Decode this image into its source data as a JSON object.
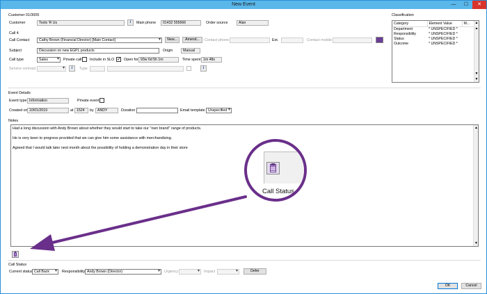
{
  "window": {
    "title": "New Event",
    "minimize": "—",
    "maximize": "☐",
    "close": "✕"
  },
  "header": {
    "customer_ref": "Customer 01/3005"
  },
  "customer": {
    "customer_label": "Customer",
    "customer_value": "Tools 'R Us",
    "main_phone_label": "Main phone",
    "main_phone_value": "01432 555666",
    "order_source_label": "Order source",
    "order_source_value": "Alan"
  },
  "call": {
    "section": "Call 4",
    "contact_label": "Call Contact",
    "contact_value": "Cathy Brown (Financial Director) [Main Contact]",
    "new_button": "New...",
    "amend_button": "Amend...",
    "contact_phone_label": "Contact phone",
    "ext_label": "Ext.",
    "contact_mobile_label": "Contact mobile",
    "subject_label": "Subject",
    "subject_value": "Discussion on new EGPL products",
    "origin_label": "Origin",
    "origin_value": "Manual",
    "call_type_label": "Call type",
    "call_type_value": "Sales",
    "private_call_label": "Private call",
    "include_slo_label": "Include in SLO",
    "open_for_label": "Open for",
    "open_for_value": "93w 6d 5h 1m",
    "time_spent_label": "Time spent",
    "time_spent_value": "1m 48s",
    "service_contract_label": "Service contract",
    "type_label": "Type"
  },
  "classification": {
    "title": "Classification",
    "headers": [
      "Category",
      "Element Value",
      "M..."
    ],
    "rows": [
      {
        "category": "Department",
        "value": "* UNSPECIFIED *"
      },
      {
        "category": "Responsibility",
        "value": "* UNSPECIFIED *"
      },
      {
        "category": "Status",
        "value": "* UNSPECIFIED *"
      },
      {
        "category": "Outcome",
        "value": "* UNSPECIFIED *"
      }
    ]
  },
  "event": {
    "section": "Event Details",
    "event_type_label": "Event type",
    "event_type_value": "Information",
    "private_event_label": "Private event",
    "created_on_label": "Created on",
    "created_on_value": "10/01/2019",
    "at_label": "at",
    "at_value": "1524",
    "by_label": "by",
    "by_value": "ANDY",
    "duration_label": "Duration",
    "email_template_label": "Email template",
    "email_template_value": "Unspecified"
  },
  "notes": {
    "label": "Notes",
    "lines": [
      "Had a long discussion with Andy Brown about whether they would start to take our \"own brand\" range of products.",
      "He is very keen to progress provided that we can give him some assistance with merchandising.",
      "Agreed that I would talk later next month about the possibility of holding a demonstration day in their store"
    ]
  },
  "callout": {
    "label": "Call Status"
  },
  "call_status": {
    "section": "Call Status",
    "current_status_label": "Current status",
    "current_status_value": "Call Back",
    "responsibility_label": "Responsibility",
    "responsibility_value": "Andy Brown (Director)",
    "urgency_label": "Urgency",
    "impact_label": "Impact",
    "defer_button": "Defer"
  },
  "footer": {
    "ok_button": "OK",
    "cancel_button": "Cancel"
  },
  "colors": {
    "titlebar": "#5ab7ea",
    "accent_purple": "#6a2f8a",
    "close_red": "#d9342b"
  }
}
